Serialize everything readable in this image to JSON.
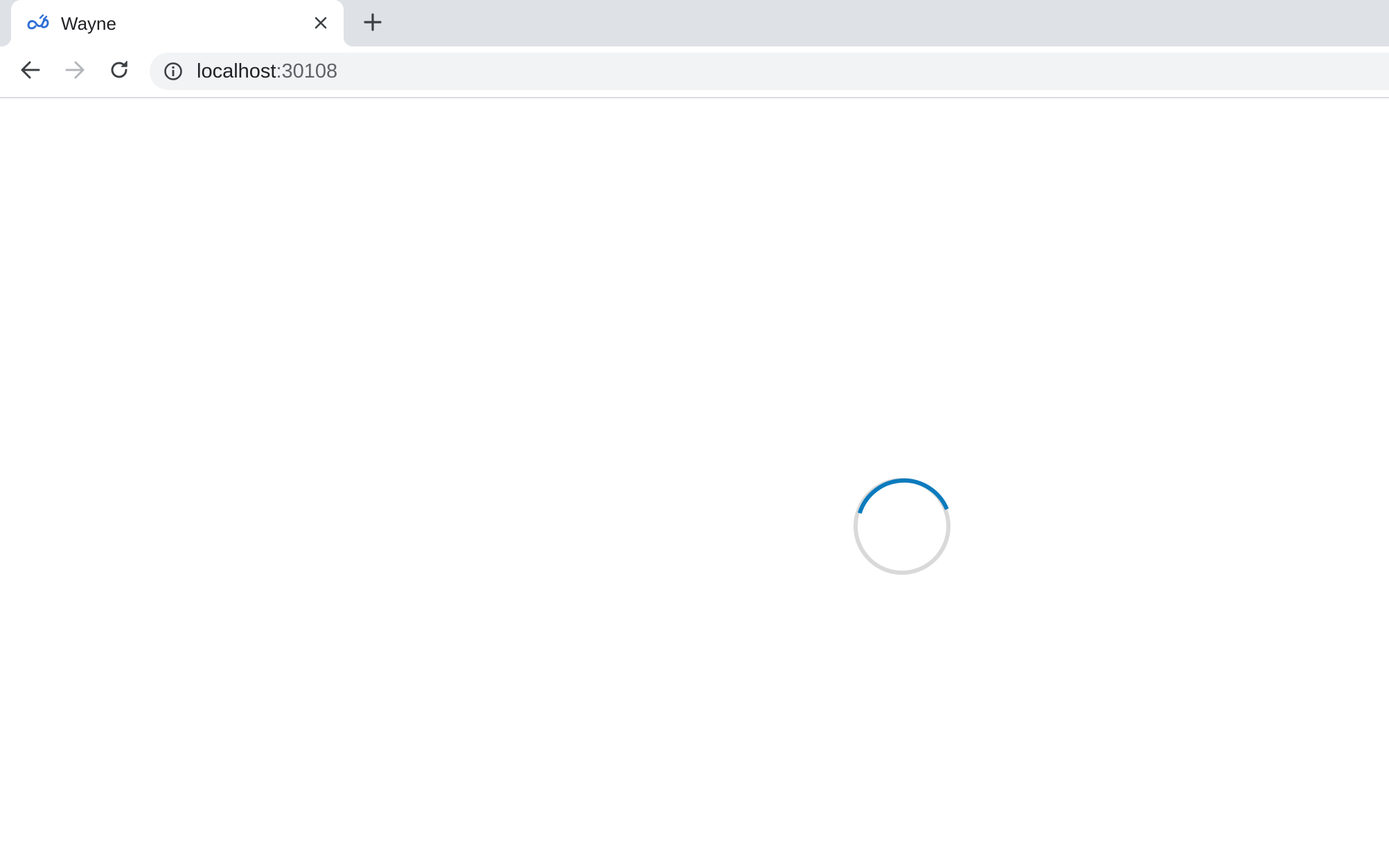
{
  "browser": {
    "tab": {
      "title": "Wayne",
      "favicon": "wayne-logo-icon",
      "close_icon": "close-icon"
    },
    "new_tab_icon": "plus-icon",
    "toolbar": {
      "back_icon": "arrow-left-icon",
      "forward_icon": "arrow-right-icon",
      "reload_icon": "reload-icon",
      "info_icon": "info-icon"
    },
    "address": {
      "host": "localhost",
      "port": ":30108"
    }
  },
  "page": {
    "state": "loading",
    "spinner_icon": "loading-spinner-icon",
    "colors": {
      "spinner_track": "#d9d9d9",
      "spinner_accent": "#0b7bbd"
    }
  }
}
